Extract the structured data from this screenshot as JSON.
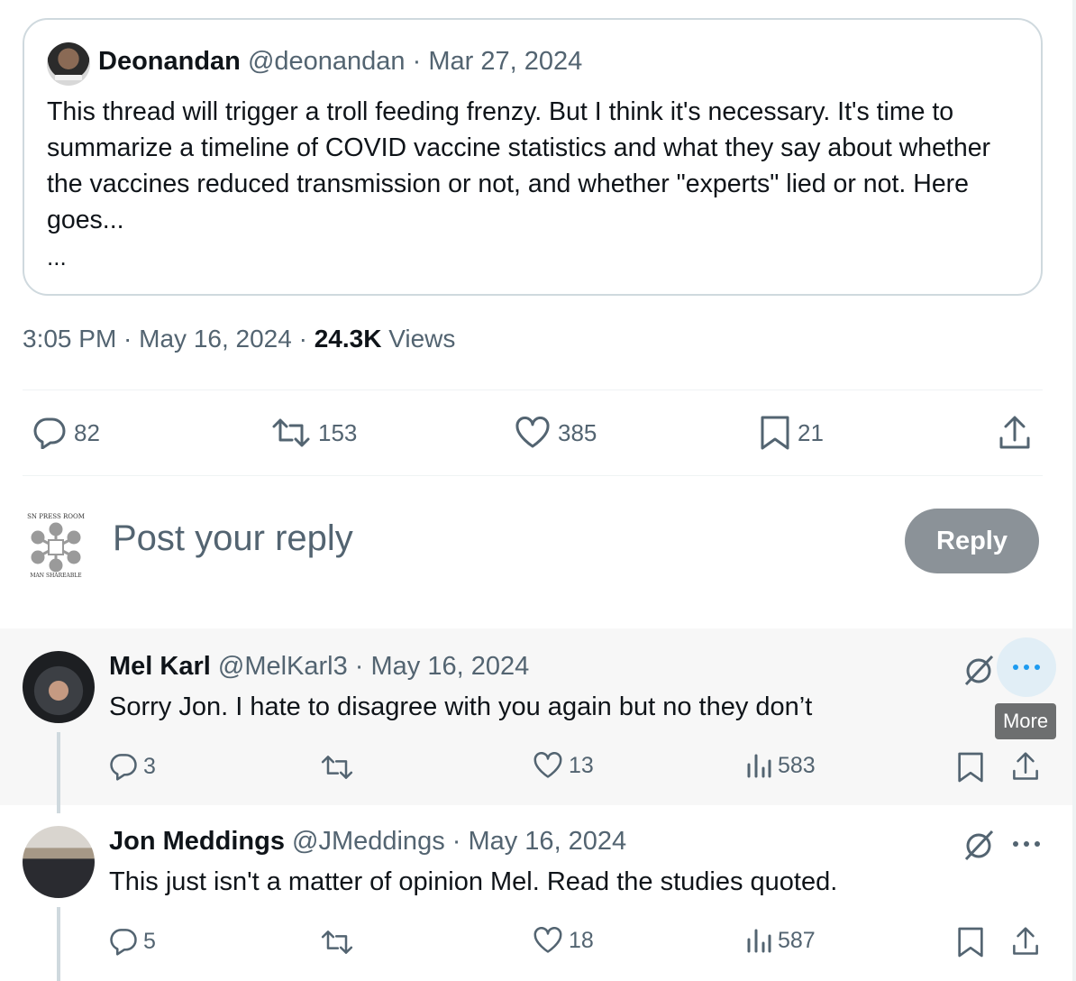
{
  "quoted": {
    "name": "Deonandan",
    "meta": " @deonandan · Mar 27, 2024",
    "text": "This thread will trigger a troll feeding frenzy. But I think it's necessary. It's time to summarize a timeline of COVID vaccine statistics and what they say about whether the vaccines reduced transmission or not, and whether \"experts\" lied or not.  Here goes...",
    "ellipsis": "..."
  },
  "post": {
    "time": "3:05 PM · May 16, 2024 · ",
    "views_count": "24.3K",
    "views_label": " Views",
    "stats": {
      "replies": "82",
      "reposts": "153",
      "likes": "385",
      "bookmarks": "21"
    }
  },
  "composer": {
    "placeholder": "Post your reply",
    "button": "Reply",
    "avatar_text_top": "SN PRESS ROOM",
    "avatar_text_bottom": "MAN SHAREABLE"
  },
  "replies": [
    {
      "name": "Mel Karl",
      "meta": " @MelKarl3 · May 16, 2024",
      "text": "Sorry Jon. I hate to disagree with you again but no they don’t",
      "replies": "3",
      "likes": "13",
      "views": "583"
    },
    {
      "name": "Jon Meddings",
      "meta": " @JMeddings · May 16, 2024",
      "text": "This just isn't a matter of opinion Mel.  Read the studies quoted.",
      "replies": "5",
      "likes": "18",
      "views": "587"
    }
  ],
  "tooltip": "More",
  "colors": {
    "text": "#0f1419",
    "muted": "#536471",
    "border": "#cfd9de",
    "reply_button": "#8b9298",
    "highlight": "#f7f7f7"
  }
}
